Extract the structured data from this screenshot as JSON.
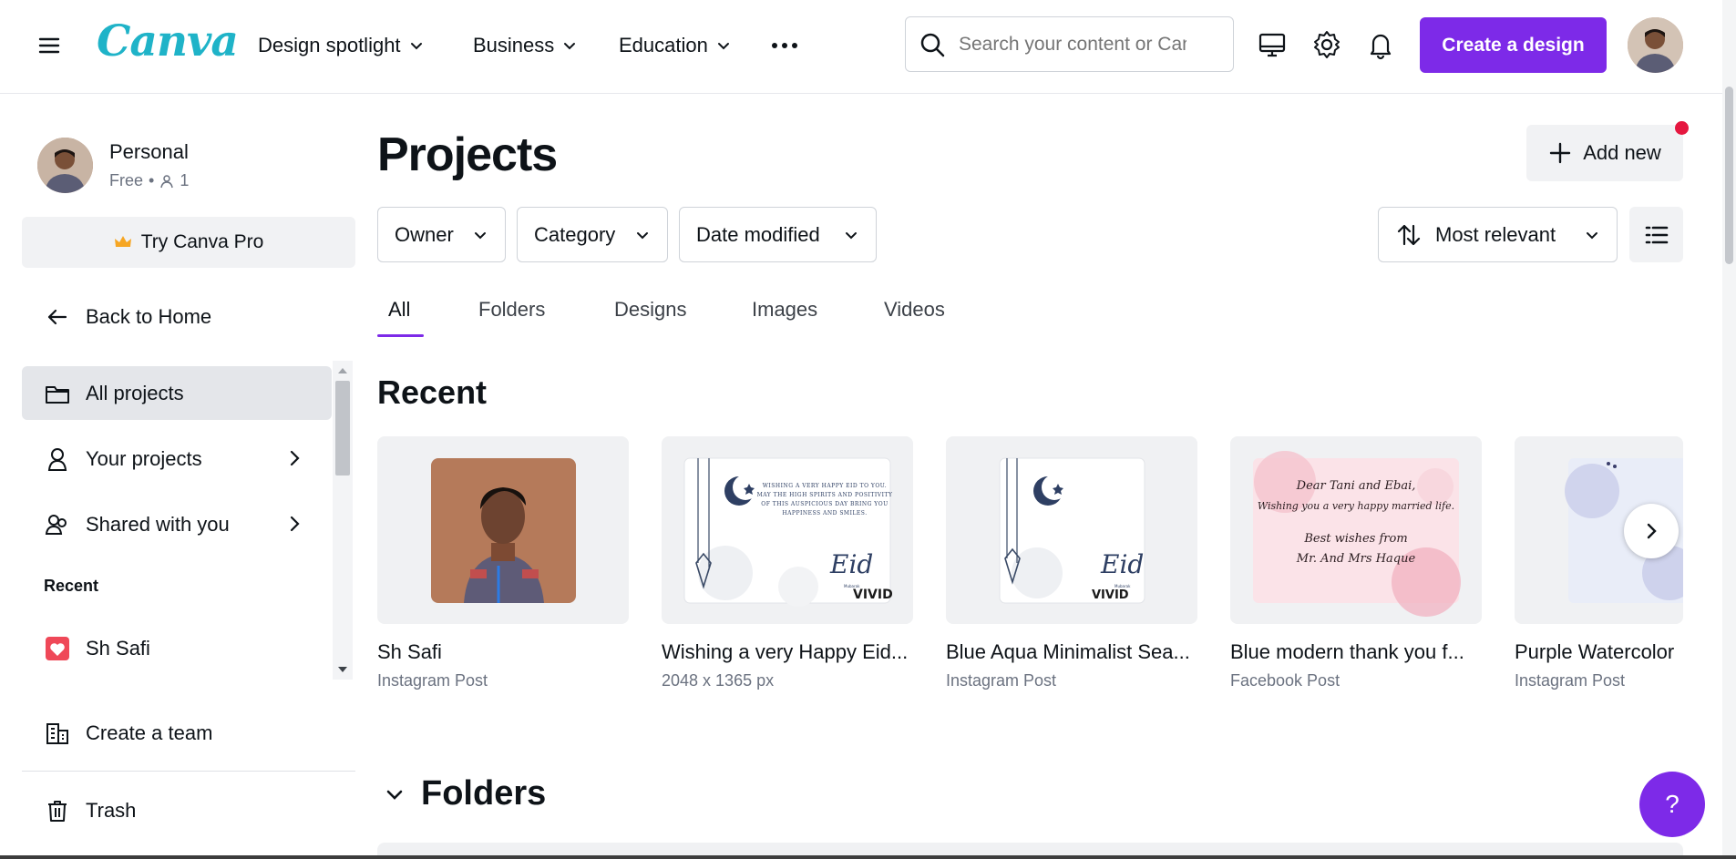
{
  "brand": {
    "logo_text": "Canva",
    "accent": "#7d2ae8",
    "logo_color": "#1fb3c8"
  },
  "topnav": {
    "items": [
      {
        "label": "Design spotlight"
      },
      {
        "label": "Business"
      },
      {
        "label": "Education"
      }
    ],
    "search_placeholder": "Search your content or Canva",
    "create_label": "Create a design",
    "icons": [
      "hamburger-icon",
      "more-icon",
      "search-icon",
      "desktop-icon",
      "gear-icon",
      "bell-icon"
    ]
  },
  "sidebar": {
    "profile": {
      "name": "Personal",
      "plan": "Free",
      "members": "1"
    },
    "try_pro_label": "Try Canva Pro",
    "back_label": "Back to Home",
    "items": [
      {
        "label": "All projects",
        "active": true
      },
      {
        "label": "Your projects"
      },
      {
        "label": "Shared with you"
      }
    ],
    "recent_heading": "Recent",
    "recent_items": [
      {
        "label": "Sh Safi"
      }
    ],
    "create_team_label": "Create a team",
    "trash_label": "Trash"
  },
  "main": {
    "title": "Projects",
    "add_new_label": "Add new",
    "filters": [
      {
        "label": "Owner"
      },
      {
        "label": "Category"
      },
      {
        "label": "Date modified"
      }
    ],
    "sort_label": "Most relevant",
    "tabs": [
      {
        "label": "All",
        "active": true
      },
      {
        "label": "Folders"
      },
      {
        "label": "Designs"
      },
      {
        "label": "Images"
      },
      {
        "label": "Videos"
      }
    ],
    "recent_heading": "Recent",
    "recent_cards": [
      {
        "title": "Sh Safi",
        "subtitle": "Instagram Post"
      },
      {
        "title": "Wishing a very Happy Eid...",
        "subtitle": "2048 x 1365 px",
        "thumb_lines": [
          "Wishing a very Happy Eid to you.",
          "May the high spirits and positivity",
          "of this auspicious day bring you",
          "happiness and smiles."
        ],
        "thumb_script": "Eid",
        "thumb_small": "Mubarak",
        "thumb_brand": "VIVID"
      },
      {
        "title": "Blue Aqua Minimalist Sea...",
        "subtitle": "Instagram Post",
        "thumb_script": "Eid",
        "thumb_small": "Mubarak",
        "thumb_brand": "VIVID"
      },
      {
        "title": "Blue modern thank you f...",
        "subtitle": "Facebook Post",
        "thumb_lines": [
          "Dear Tani and Ebai,",
          "Wishing you a very happy married life.",
          "Best wishes from",
          "Mr. And Mrs Haque"
        ]
      },
      {
        "title": "Purple Watercolor",
        "subtitle": "Instagram Post"
      }
    ],
    "folders_heading": "Folders",
    "help_label": "?"
  }
}
